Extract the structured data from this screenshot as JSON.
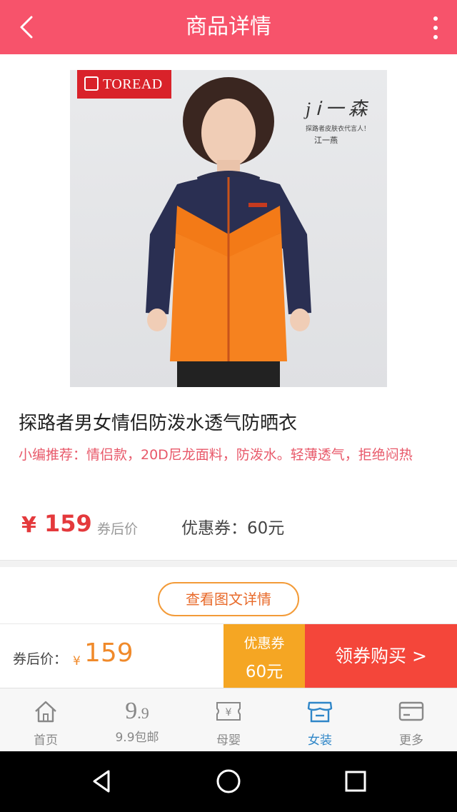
{
  "header": {
    "title": "商品详情"
  },
  "product": {
    "brand": "TOREAD",
    "signature": {
      "script": "j ⅰ 一 森",
      "caption": "探路者皮肤衣代言人！",
      "name": "江一燕"
    },
    "title": "探路者男女情侣防泼水透气防晒衣",
    "recommend": "小编推荐：情侣款，20D尼龙面料，防泼水。轻薄透气，拒绝闷热",
    "currency": "¥",
    "price": "159",
    "price_note": "券后价",
    "coupon_text": "优惠券：60元"
  },
  "detail_button": "查看图文详情",
  "buy_bar": {
    "label": "券后价：",
    "currency": "¥",
    "price": "159",
    "coupon_line1": "优惠券",
    "coupon_line2": "60元",
    "buy_label": "领券购买 >"
  },
  "tabs": [
    {
      "label": "首页",
      "icon": "home-icon"
    },
    {
      "label": "9.9包邮",
      "icon": "nine-nine-icon",
      "icon_text": "9",
      "icon_small": ".9"
    },
    {
      "label": "母婴",
      "icon": "baby-icon"
    },
    {
      "label": "女装",
      "icon": "store-icon",
      "active": true
    },
    {
      "label": "更多",
      "icon": "card-icon"
    }
  ],
  "colors": {
    "header": "#f7536b",
    "price": "#e4393c",
    "accent_orange": "#f5a623",
    "buy": "#f4463a",
    "active_tab": "#2f86c8"
  }
}
